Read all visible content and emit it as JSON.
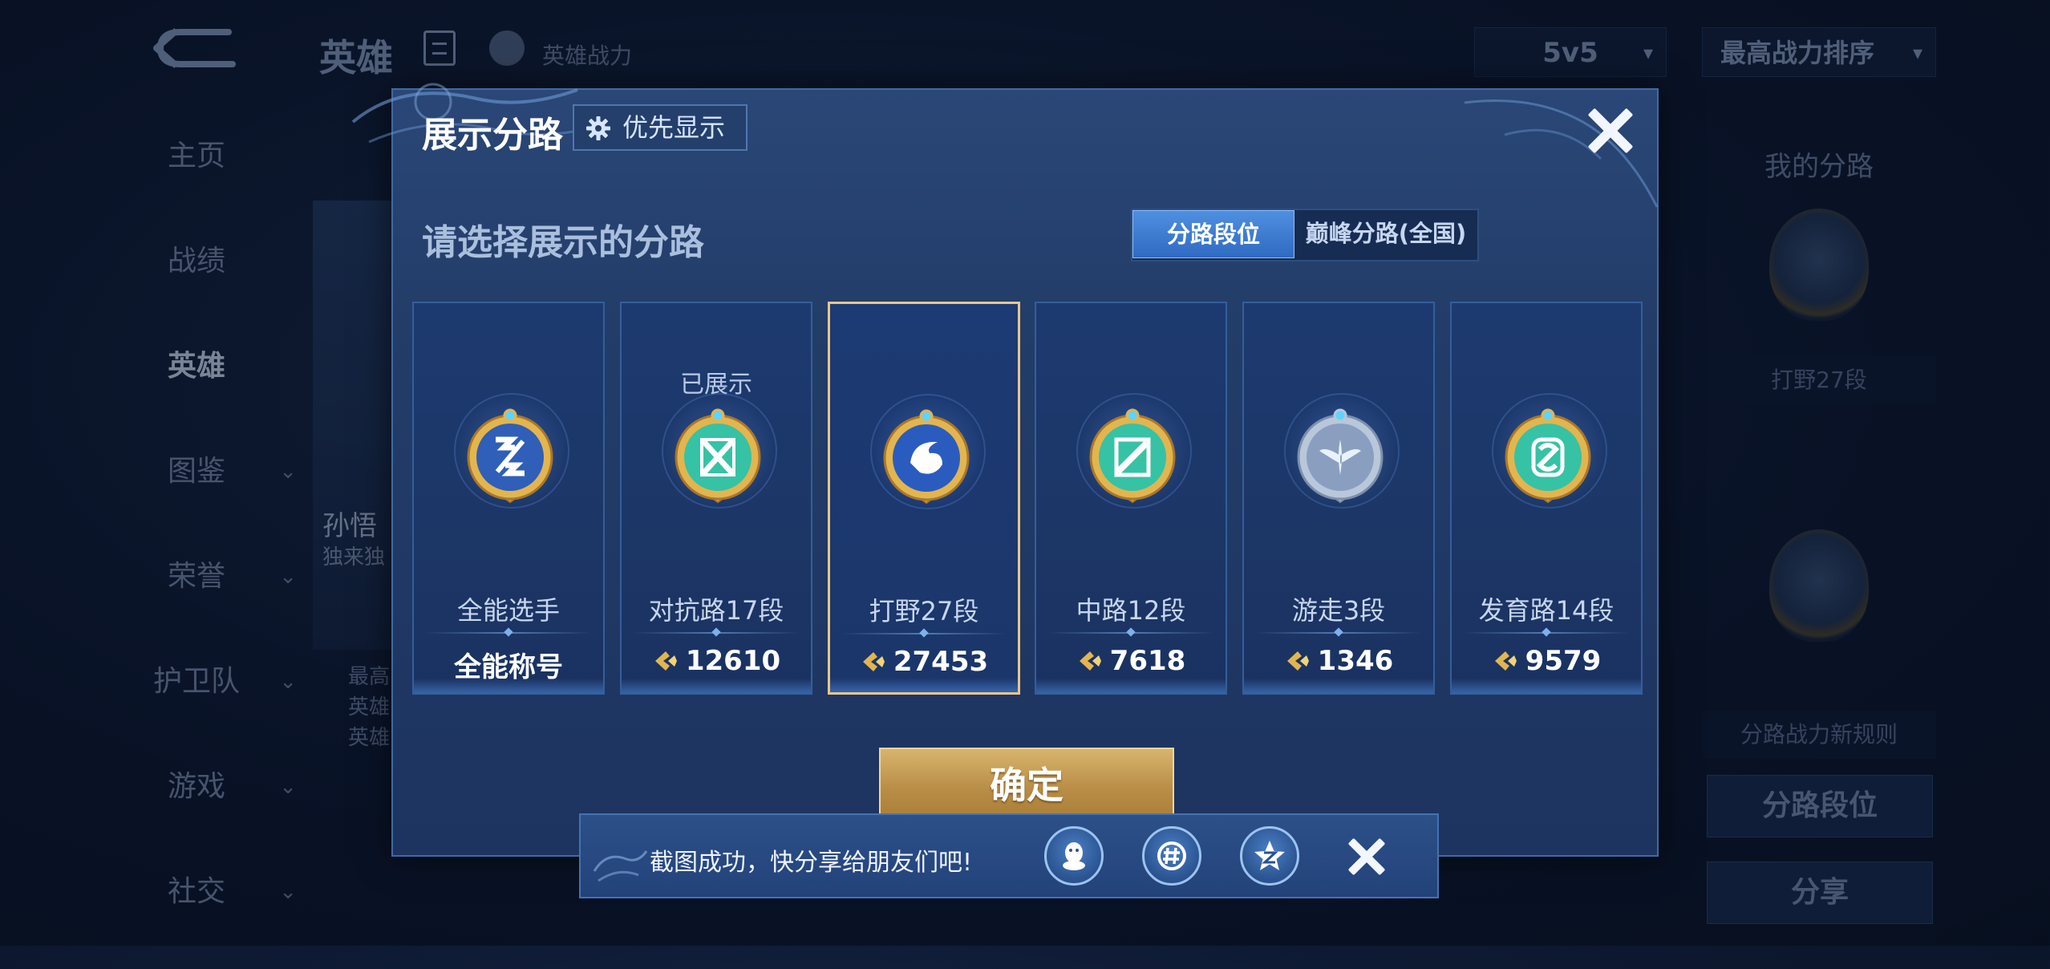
{
  "background": {
    "title": "英雄",
    "power_label": "英雄战力",
    "mode_select": "5v5",
    "sort_select": "最高战力排序",
    "nav": [
      {
        "label": "主页",
        "chevron": false
      },
      {
        "label": "战绩",
        "chevron": false
      },
      {
        "label": "英雄",
        "chevron": false,
        "active": true
      },
      {
        "label": "图鉴",
        "chevron": true
      },
      {
        "label": "荣誉",
        "chevron": true
      },
      {
        "label": "护卫队",
        "chevron": true
      },
      {
        "label": "游戏",
        "chevron": true
      },
      {
        "label": "社交",
        "chevron": true
      }
    ],
    "hero_name": "孙悟",
    "hero_sub": "独来独",
    "hero_info": [
      "最高",
      "英雄",
      "英雄"
    ],
    "right_panel": {
      "title": "我的分路",
      "badge_label": "打野27段",
      "rule_label": "分路战力新规则",
      "lane_rank_button": "分路段位",
      "share_button": "分享"
    }
  },
  "modal": {
    "title": "展示分路",
    "priority_button": "优先显示",
    "subtitle": "请选择展示的分路",
    "tabs": {
      "active": "分路段位",
      "inactive": "巅峰分路(全国)"
    },
    "cards": [
      {
        "lane": "全能选手",
        "score": "全能称号",
        "shown": "",
        "badge": "all",
        "color": "#2f5fb8",
        "has_icon": false
      },
      {
        "lane": "对抗路17段",
        "score": "12610",
        "shown": "已展示",
        "badge": "clash",
        "color": "#36c2a5",
        "has_icon": true
      },
      {
        "lane": "打野27段",
        "score": "27453",
        "shown": "",
        "badge": "jungle",
        "color": "#2a5cc0",
        "has_icon": true,
        "selected": true
      },
      {
        "lane": "中路12段",
        "score": "7618",
        "shown": "",
        "badge": "mid",
        "color": "#36c2a5",
        "has_icon": true
      },
      {
        "lane": "游走3段",
        "score": "1346",
        "shown": "",
        "badge": "roam",
        "color": "#8a9fc0",
        "has_icon": true
      },
      {
        "lane": "发育路14段",
        "score": "9579",
        "shown": "",
        "badge": "farm",
        "color": "#36c2a5",
        "has_icon": true
      }
    ],
    "confirm_button": "确定"
  },
  "toast": {
    "text": "截图成功，快分享给朋友们吧!",
    "share_targets": [
      "qq-icon",
      "wechat-moments-icon",
      "qzone-icon"
    ]
  }
}
